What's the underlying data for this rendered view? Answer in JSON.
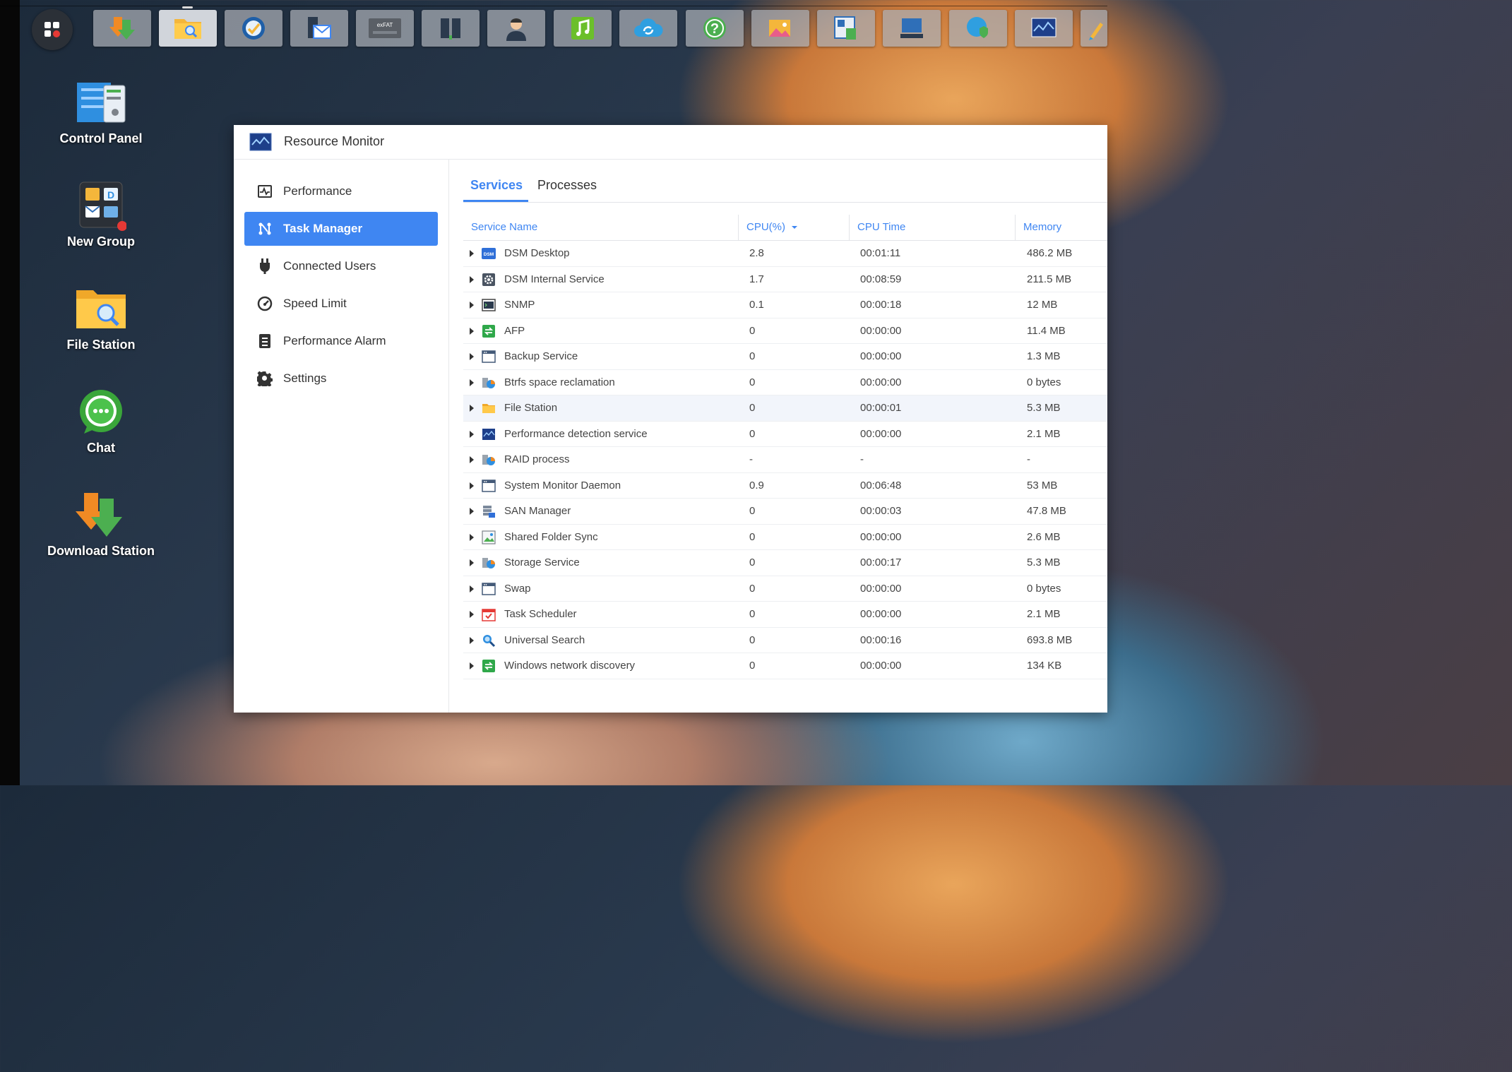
{
  "taskbar": {
    "apps": [
      {
        "name": "download-station-icon",
        "active": false
      },
      {
        "name": "file-station-icon",
        "active": true
      },
      {
        "name": "speed-icon",
        "active": false
      },
      {
        "name": "mail-server-icon",
        "active": false
      },
      {
        "name": "exfat-icon",
        "active": false
      },
      {
        "name": "storage-icon",
        "active": false
      },
      {
        "name": "user-icon",
        "active": false
      },
      {
        "name": "audio-station-icon",
        "active": false
      },
      {
        "name": "cloud-sync-icon",
        "active": false
      },
      {
        "name": "help-icon",
        "active": false
      },
      {
        "name": "photo-icon",
        "active": false
      },
      {
        "name": "storage-manager-icon",
        "active": false
      },
      {
        "name": "server-icon",
        "active": false
      },
      {
        "name": "security-advisor-icon",
        "active": false
      },
      {
        "name": "resource-monitor-icon",
        "active": false
      },
      {
        "name": "pen-icon",
        "active": false
      }
    ]
  },
  "desktop": {
    "icons": [
      {
        "label": "Control Panel"
      },
      {
        "label": "New Group"
      },
      {
        "label": "File Station"
      },
      {
        "label": "Chat"
      },
      {
        "label": "Download Station"
      }
    ]
  },
  "window": {
    "title": "Resource Monitor",
    "sidebar": [
      {
        "label": "Performance",
        "icon": "performance-icon"
      },
      {
        "label": "Task Manager",
        "icon": "task-manager-icon"
      },
      {
        "label": "Connected Users",
        "icon": "plug-icon"
      },
      {
        "label": "Speed Limit",
        "icon": "gauge-icon"
      },
      {
        "label": "Performance Alarm",
        "icon": "alarm-doc-icon"
      },
      {
        "label": "Settings",
        "icon": "gear-icon"
      }
    ],
    "tabs": [
      "Services",
      "Processes"
    ],
    "columns": {
      "name": "Service Name",
      "cpu": "CPU(%)",
      "cpu_time": "CPU Time",
      "memory": "Memory"
    },
    "rows": [
      {
        "name": "DSM Desktop",
        "cpu": "2.8",
        "cpu_time": "00:01:11",
        "memory": "486.2 MB",
        "icon": "dsm-icon"
      },
      {
        "name": "DSM Internal Service",
        "cpu": "1.7",
        "cpu_time": "00:08:59",
        "memory": "211.5 MB",
        "icon": "gear-box-icon"
      },
      {
        "name": "SNMP",
        "cpu": "0.1",
        "cpu_time": "00:00:18",
        "memory": "12 MB",
        "icon": "terminal-icon"
      },
      {
        "name": "AFP",
        "cpu": "0",
        "cpu_time": "00:00:00",
        "memory": "11.4 MB",
        "icon": "network-share-icon"
      },
      {
        "name": "Backup Service",
        "cpu": "0",
        "cpu_time": "00:00:00",
        "memory": "1.3 MB",
        "icon": "window-icon"
      },
      {
        "name": "Btrfs space reclamation",
        "cpu": "0",
        "cpu_time": "00:00:00",
        "memory": "0 bytes",
        "icon": "storage-pie-icon"
      },
      {
        "name": "File Station",
        "cpu": "0",
        "cpu_time": "00:00:01",
        "memory": "5.3 MB",
        "icon": "folder-icon"
      },
      {
        "name": "Performance detection service",
        "cpu": "0",
        "cpu_time": "00:00:00",
        "memory": "2.1 MB",
        "icon": "monitor-icon"
      },
      {
        "name": "RAID process",
        "cpu": "-",
        "cpu_time": "-",
        "memory": "-",
        "icon": "storage-pie-icon"
      },
      {
        "name": "System Monitor Daemon",
        "cpu": "0.9",
        "cpu_time": "00:06:48",
        "memory": "53 MB",
        "icon": "window-icon"
      },
      {
        "name": "SAN Manager",
        "cpu": "0",
        "cpu_time": "00:00:03",
        "memory": "47.8 MB",
        "icon": "san-icon"
      },
      {
        "name": "Shared Folder Sync",
        "cpu": "0",
        "cpu_time": "00:00:00",
        "memory": "2.6 MB",
        "icon": "sync-image-icon"
      },
      {
        "name": "Storage Service",
        "cpu": "0",
        "cpu_time": "00:00:17",
        "memory": "5.3 MB",
        "icon": "storage-pie-icon"
      },
      {
        "name": "Swap",
        "cpu": "0",
        "cpu_time": "00:00:00",
        "memory": "0 bytes",
        "icon": "window-icon"
      },
      {
        "name": "Task Scheduler",
        "cpu": "0",
        "cpu_time": "00:00:00",
        "memory": "2.1 MB",
        "icon": "calendar-check-icon"
      },
      {
        "name": "Universal Search",
        "cpu": "0",
        "cpu_time": "00:00:16",
        "memory": "693.8 MB",
        "icon": "search-icon"
      },
      {
        "name": "Windows network discovery",
        "cpu": "0",
        "cpu_time": "00:00:00",
        "memory": "134 KB",
        "icon": "network-share-icon"
      }
    ]
  },
  "colors": {
    "accent": "#3f86f2",
    "window_bg": "#ffffff",
    "text": "#333333"
  }
}
